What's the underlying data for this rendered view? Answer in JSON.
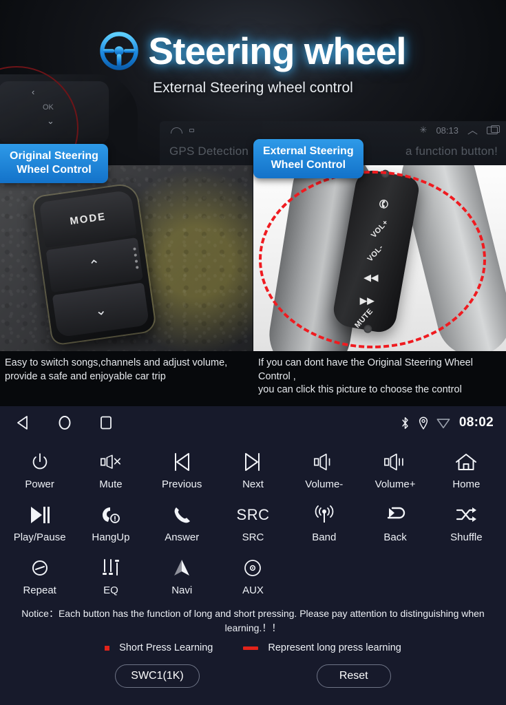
{
  "hero": {
    "title": "Steering wheel",
    "subtitle": "External Steering wheel control",
    "logo_icon": "steering-wheel-icon",
    "background_head_unit": {
      "time": "08:13",
      "left_text": "GPS Detection",
      "right_text": "a function button!",
      "icons": [
        "home-outline-icon",
        "recent-apps-icon",
        "bluetooth-icon",
        "chevron-up-icon",
        "window-icon"
      ]
    },
    "panels": [
      {
        "badge": "Original Steering\nWheel Control",
        "badge_line1": "Original Steering",
        "badge_line2": "Wheel Control",
        "photo_alt": "oem-steering-wheel-control-photo",
        "button_labels": [
          "MODE",
          "up-chevron",
          "down-chevron"
        ],
        "caption_line1": "Easy to switch songs,channels and adjust volume,",
        "caption_line2": "provide a safe and enjoyable car trip"
      },
      {
        "badge_line1": "External Steering",
        "badge_line2": "Wheel Control",
        "photo_alt": "external-steering-wheel-control-photo",
        "button_labels": [
          "call-icon",
          "VOL+",
          "VOL-",
          "prev-icon",
          "next-icon",
          "MUTE"
        ],
        "caption_line1": "If you can dont have the Original Steering Wheel Control ,",
        "caption_line2": "you can click this picture to choose the control"
      }
    ]
  },
  "navbar": {
    "back_icon": "back-triangle-icon",
    "home_icon": "home-circle-icon",
    "recents_icon": "recents-square-icon",
    "status_icons": [
      "bluetooth-icon",
      "location-pin-icon",
      "wifi-icon"
    ],
    "time": "08:02"
  },
  "grid": {
    "buttons": [
      {
        "label": "Power",
        "icon": "power-icon"
      },
      {
        "label": "Mute",
        "icon": "mute-icon"
      },
      {
        "label": "Previous",
        "icon": "previous-track-icon"
      },
      {
        "label": "Next",
        "icon": "next-track-icon"
      },
      {
        "label": "Volume-",
        "icon": "volume-down-icon"
      },
      {
        "label": "Volume+",
        "icon": "volume-up-icon"
      },
      {
        "label": "Home",
        "icon": "home-icon"
      },
      {
        "label": "Play/Pause",
        "icon": "play-pause-icon"
      },
      {
        "label": "HangUp",
        "icon": "hang-up-icon"
      },
      {
        "label": "Answer",
        "icon": "answer-call-icon"
      },
      {
        "label": "SRC",
        "icon": "src-text-icon",
        "icon_text": "SRC"
      },
      {
        "label": "Band",
        "icon": "band-antenna-icon"
      },
      {
        "label": "Back",
        "icon": "back-arrow-icon"
      },
      {
        "label": "Shuffle",
        "icon": "shuffle-icon"
      },
      {
        "label": "Repeat",
        "icon": "repeat-icon"
      },
      {
        "label": "EQ",
        "icon": "equalizer-icon"
      },
      {
        "label": "Navi",
        "icon": "navigation-arrow-icon"
      },
      {
        "label": "AUX",
        "icon": "aux-disc-icon"
      }
    ]
  },
  "notice": {
    "line1": "Notice：Each button has the function of long and short pressing. Please pay attention to distinguishing when",
    "line2": "learning.！！"
  },
  "legend": {
    "short_press": "Short Press Learning",
    "long_press": "Represent long press learning",
    "marker_color": "#e2231a"
  },
  "footer": {
    "swc_button": "SWC1(1K)",
    "reset_button": "Reset"
  },
  "colors": {
    "background": "#171a2b",
    "accent_blue": "#1f8ddd",
    "text": "#eef1f6",
    "red": "#e2231a"
  }
}
